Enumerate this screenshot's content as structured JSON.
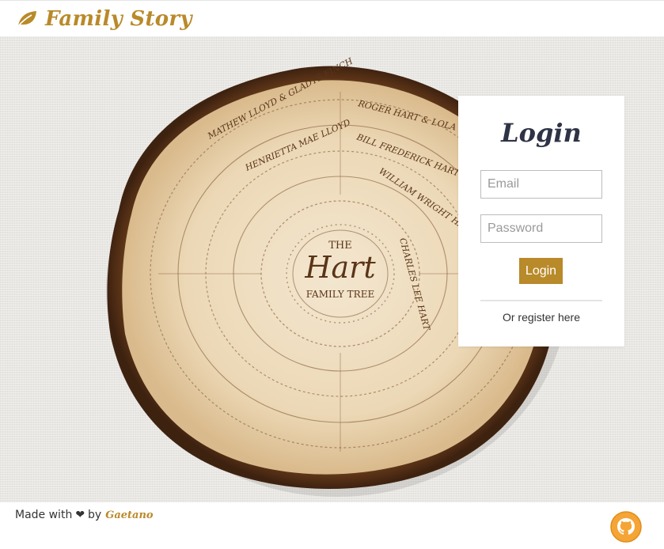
{
  "navbar": {
    "brand_icon": "leaf-icon",
    "brand_name": "Family Story"
  },
  "hero": {
    "background_image": "engraved wood slice family tree",
    "wood_center_text": {
      "line1": "THE",
      "line2": "Hart",
      "line3": "FAMILY TREE"
    },
    "ring_names": [
      "MATHEW LLOYD & GLADYS FINCH",
      "ROGER HART & LOLA KAMAI",
      "HENRIETTA MAE LLOYD",
      "BILL FREDERICK HART",
      "WILLIAM WRIGHT HART",
      "CHARLES LEE HART"
    ]
  },
  "login": {
    "title": "Login",
    "email_placeholder": "Email",
    "password_placeholder": "Password",
    "submit_label": "Login",
    "register_text": "Or register here"
  },
  "footer": {
    "made_with": "Made with",
    "heart_icon": "heart-icon",
    "by": "by",
    "author": "Gaetano",
    "github_icon": "github-icon"
  },
  "colors": {
    "brand": "#b98a2a",
    "title_dark": "#2e3346",
    "button_bg": "#b98a2a"
  }
}
